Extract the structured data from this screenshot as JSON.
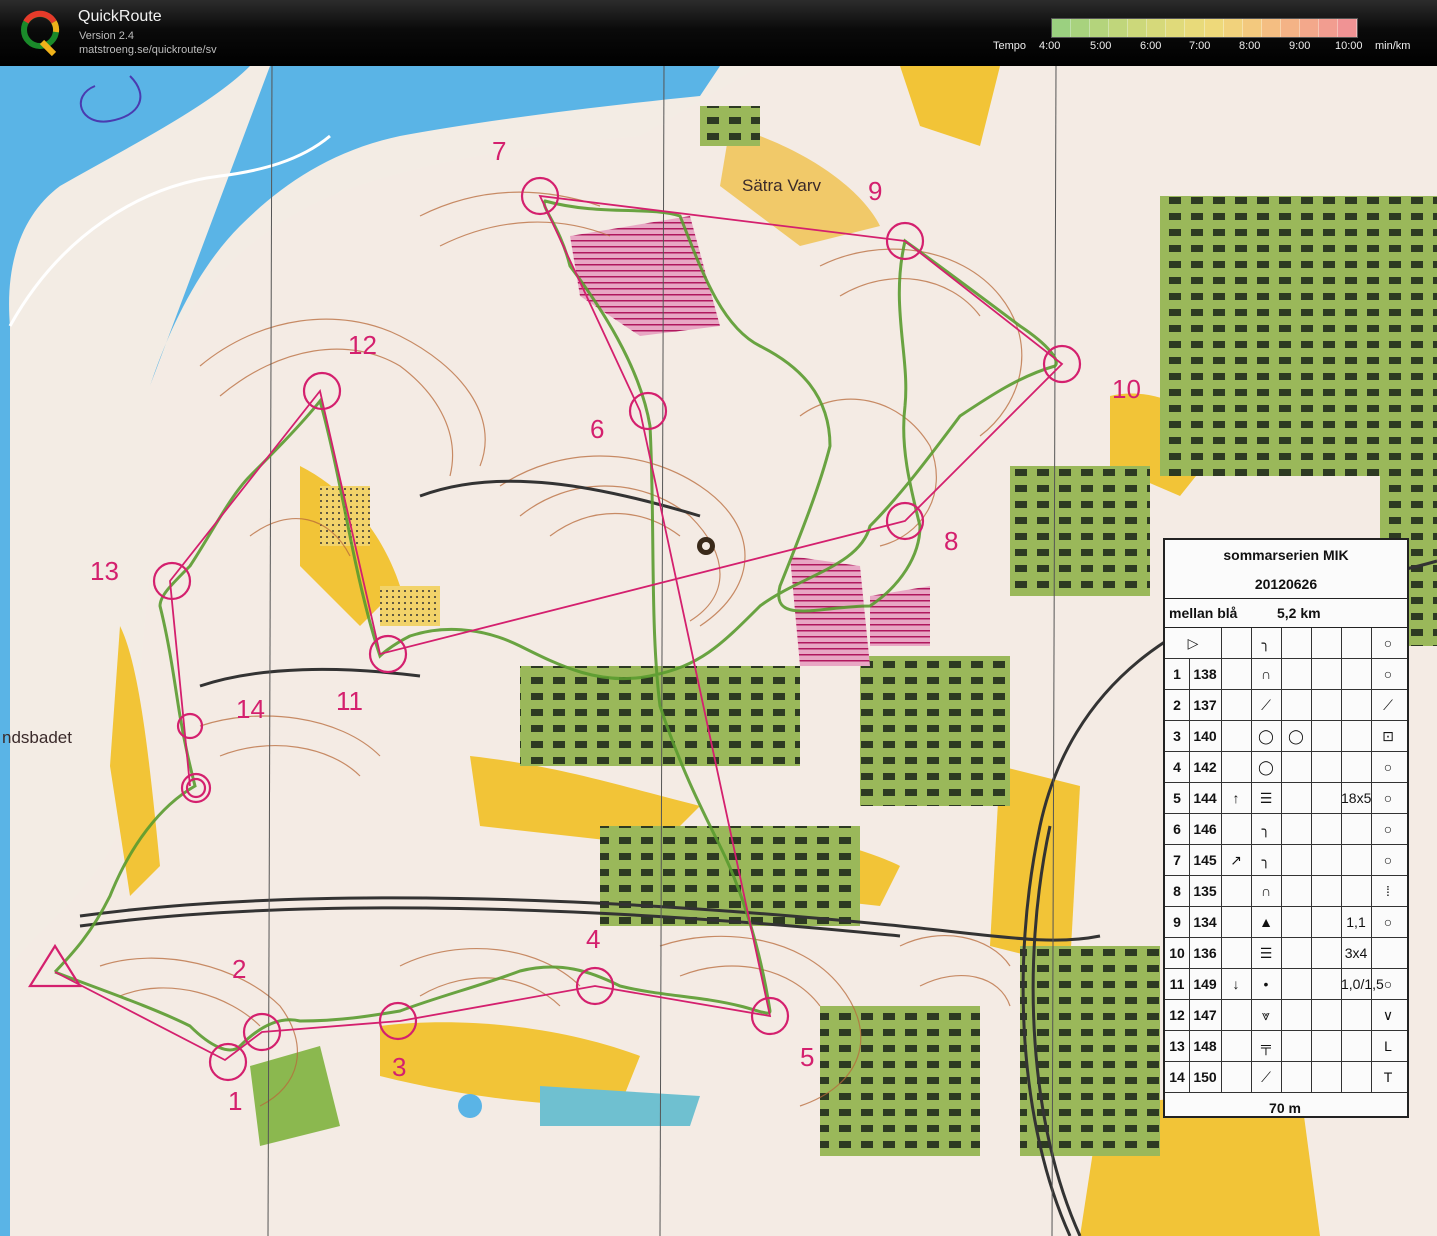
{
  "header": {
    "app_title": "QuickRoute",
    "version": "Version 2.4",
    "url": "matstroeng.se/quickroute/sv",
    "logo_letter": "Q",
    "tempo_label": "Tempo",
    "tempo_ticks": [
      "4:00",
      "5:00",
      "6:00",
      "7:00",
      "8:00",
      "9:00",
      "10:00"
    ],
    "tempo_unit": "min/km"
  },
  "map": {
    "place_labels": {
      "satra_varv": "Sätra Varv",
      "badet": "ndsbadet"
    },
    "controls": [
      {
        "label": "1"
      },
      {
        "label": "2"
      },
      {
        "label": "3"
      },
      {
        "label": "4"
      },
      {
        "label": "5"
      },
      {
        "label": "6"
      },
      {
        "label": "7"
      },
      {
        "label": "8"
      },
      {
        "label": "9"
      },
      {
        "label": "10"
      },
      {
        "label": "11"
      },
      {
        "label": "12"
      },
      {
        "label": "13"
      },
      {
        "label": "14"
      }
    ],
    "colors": {
      "water": "#5ab4e6",
      "open_land": "#f2c437",
      "forest": "#f3ece4",
      "green": "#8bb84f",
      "course": "#d4206e",
      "route": "#5a9b2f",
      "contour": "#b86a3a"
    }
  },
  "description_sheet": {
    "title": "sommarserien MIK",
    "date": "20120626",
    "class": "mellan blå",
    "length": "5,2 km",
    "start_symbol": "▷",
    "start_feature": "╮",
    "rows": [
      {
        "num": "1",
        "code": "138",
        "c": "",
        "d": "∩",
        "e": "",
        "f": "",
        "g": "",
        "h": "○"
      },
      {
        "num": "2",
        "code": "137",
        "c": "",
        "d": "⟋",
        "e": "",
        "f": "",
        "g": "",
        "h": "⟋"
      },
      {
        "num": "3",
        "code": "140",
        "c": "",
        "d": "◯",
        "e": "◯",
        "f": "",
        "g": "",
        "h": "⊡"
      },
      {
        "num": "4",
        "code": "142",
        "c": "",
        "d": "◯",
        "e": "",
        "f": "",
        "g": "",
        "h": "○"
      },
      {
        "num": "5",
        "code": "144",
        "c": "↑",
        "d": "☰",
        "e": "",
        "f": "",
        "g": "18x5",
        "h": "○"
      },
      {
        "num": "6",
        "code": "146",
        "c": "",
        "d": "╮",
        "e": "",
        "f": "",
        "g": "",
        "h": "○"
      },
      {
        "num": "7",
        "code": "145",
        "c": "↗",
        "d": "╮",
        "e": "",
        "f": "",
        "g": "",
        "h": "○"
      },
      {
        "num": "8",
        "code": "135",
        "c": "",
        "d": "∩",
        "e": "",
        "f": "",
        "g": "",
        "h": "⁞"
      },
      {
        "num": "9",
        "code": "134",
        "c": "",
        "d": "▲",
        "e": "",
        "f": "",
        "g": "1,1",
        "h": "○"
      },
      {
        "num": "10",
        "code": "136",
        "c": "",
        "d": "☰",
        "e": "",
        "f": "",
        "g": "3x4",
        "h": ""
      },
      {
        "num": "11",
        "code": "149",
        "c": "↓",
        "d": "•",
        "e": "",
        "f": "",
        "g": "1,0/1,5",
        "h": "○"
      },
      {
        "num": "12",
        "code": "147",
        "c": "",
        "d": "⩔",
        "e": "",
        "f": "",
        "g": "",
        "h": "∨"
      },
      {
        "num": "13",
        "code": "148",
        "c": "",
        "d": "╤",
        "e": "",
        "f": "",
        "g": "",
        "h": "L"
      },
      {
        "num": "14",
        "code": "150",
        "c": "",
        "d": "⟋",
        "e": "",
        "f": "",
        "g": "",
        "h": "T"
      }
    ],
    "footer": "70 m"
  }
}
